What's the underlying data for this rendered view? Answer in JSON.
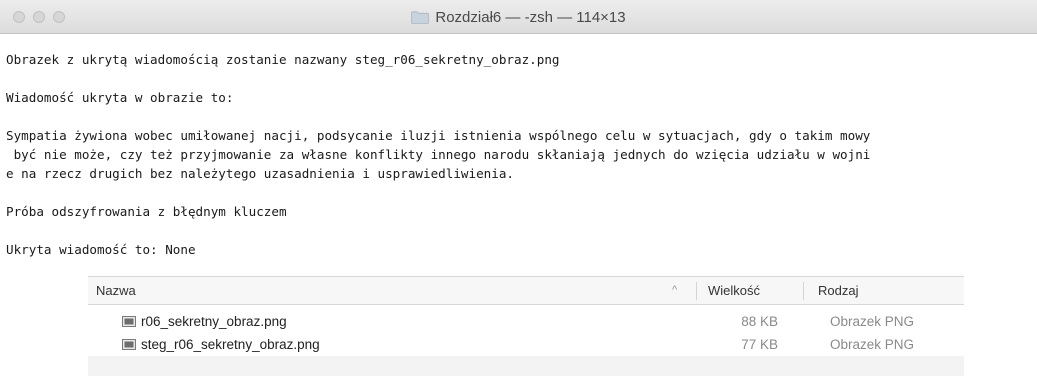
{
  "window": {
    "title": "Rozdział6 — -zsh — 114×13"
  },
  "terminal": {
    "lines": [
      "Obrazek z ukrytą wiadomością zostanie nazwany steg_r06_sekretny_obraz.png",
      "",
      "Wiadomość ukryta w obrazie to:",
      "",
      "Sympatia żywiona wobec umiłowanej nacji, podsycanie iluzji istnienia wspólnego celu w sytuacjach, gdy o takim mowy",
      " być nie może, czy też przyjmowanie za własne konflikty innego narodu skłaniają jednych do wzięcia udziału w wojni",
      "e na rzecz drugich bez należytego uzasadnienia i usprawiedliwienia.",
      "",
      "Próba odszyfrowania z błędnym kluczem",
      "",
      "Ukryta wiadomość to: None"
    ]
  },
  "file_list": {
    "headers": {
      "name": "Nazwa",
      "sort_indicator": "^",
      "size": "Wielkość",
      "kind": "Rodzaj"
    },
    "rows": [
      {
        "name": "r06_sekretny_obraz.png",
        "size": "88 KB",
        "kind": "Obrazek PNG",
        "icon": "png-file-icon"
      },
      {
        "name": "steg_r06_sekretny_obraz.png",
        "size": "77 KB",
        "kind": "Obrazek PNG",
        "icon": "png-file-icon"
      }
    ]
  }
}
